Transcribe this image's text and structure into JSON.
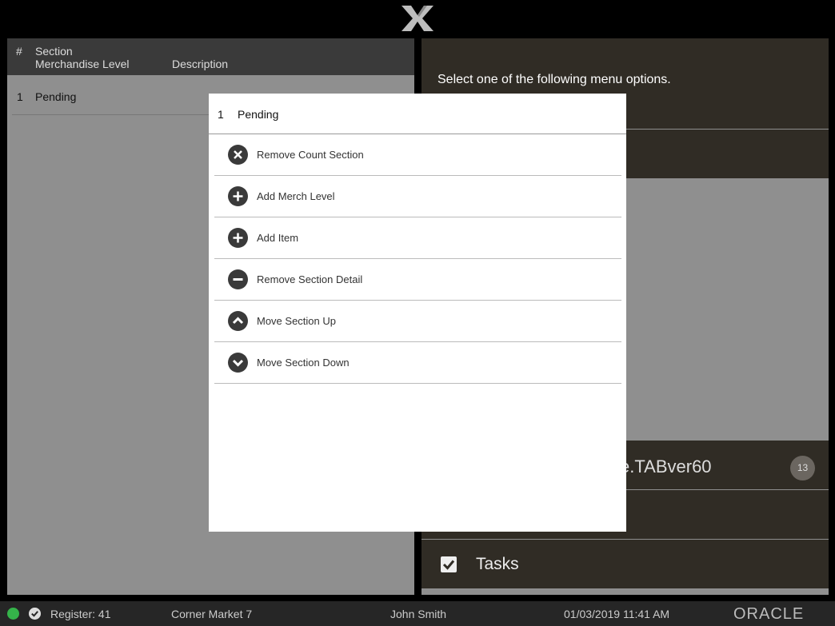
{
  "left_list": {
    "columns": {
      "hash": "#",
      "section": "Section",
      "merch_level": "Merchandise Level",
      "description": "Description"
    },
    "rows": [
      {
        "num": "1",
        "status": "Pending"
      }
    ]
  },
  "right_panel": {
    "prompt": "Select one of the following menu options.",
    "item_title": "e.TABver60",
    "item_badge": "13",
    "tasks_label": "Tasks"
  },
  "modal": {
    "header": {
      "num": "1",
      "status": "Pending"
    },
    "items": [
      {
        "label": "Remove Count Section",
        "icon": "x-circle-icon"
      },
      {
        "label": "Add Merch Level",
        "icon": "plus-circle-icon"
      },
      {
        "label": "Add Item",
        "icon": "plus-circle-icon"
      },
      {
        "label": "Remove Section Detail",
        "icon": "minus-circle-icon"
      },
      {
        "label": "Move Section Up",
        "icon": "chevron-up-circle-icon"
      },
      {
        "label": "Move Section Down",
        "icon": "chevron-down-circle-icon"
      }
    ]
  },
  "status_bar": {
    "register": "Register: 41",
    "store": "Corner Market 7",
    "user": "John Smith",
    "datetime": "01/03/2019 11:41 AM",
    "brand": "ORACLE"
  },
  "colors": {
    "panel_dark": "#302c25",
    "online": "#35b34a",
    "icon": "#3a3a3a"
  }
}
